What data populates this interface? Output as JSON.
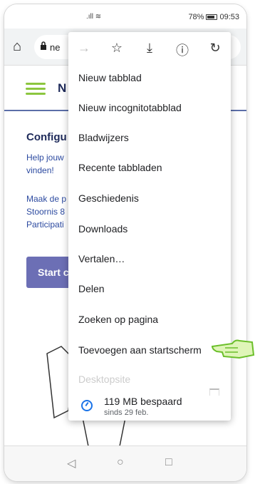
{
  "status": {
    "battery": "78%",
    "time": "09:53"
  },
  "browser": {
    "url_fragment": "ne"
  },
  "page": {
    "brand": "N",
    "heading": "Configu",
    "para1_line1": "Help jouw",
    "para1_line2": "vinden!",
    "para2_line1": "Maak de p",
    "para2_line2": "Stoornis 8",
    "para2_line3": "Participati",
    "start_button": "Start c"
  },
  "menu": {
    "items": [
      "Nieuw tabblad",
      "Nieuw incognitotabblad",
      "Bladwijzers",
      "Recente tabbladen",
      "Geschiedenis",
      "Downloads",
      "Vertalen…",
      "Delen",
      "Zoeken op pagina",
      "Toevoegen aan startscherm",
      "Desktopsite"
    ],
    "savings_title": "119 MB bespaard",
    "savings_sub": "sinds 29 feb."
  },
  "icons": {
    "back": "arrow-forward-icon",
    "star": "star-icon",
    "download": "download-icon",
    "info": "info-icon",
    "refresh": "refresh-icon"
  },
  "colors": {
    "accent_green": "#8cc63f",
    "brand_blue": "#1e2a5a",
    "button_purple": "#6c6fb5"
  }
}
